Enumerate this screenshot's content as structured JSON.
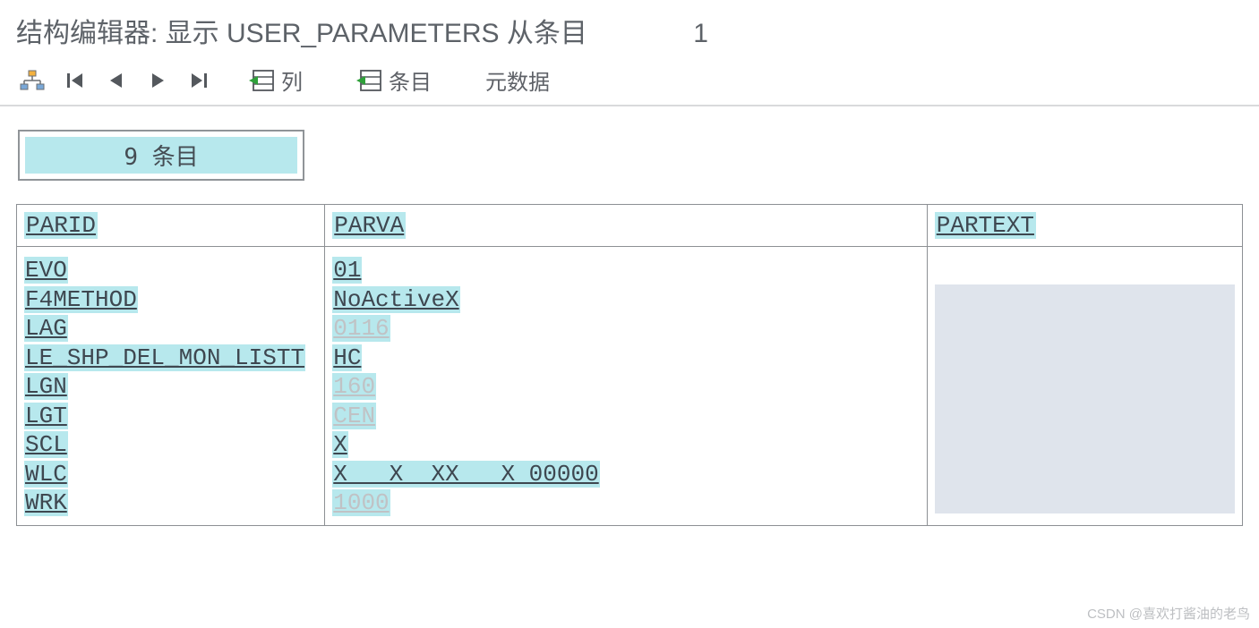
{
  "title": {
    "prefix": "结构编辑器: 显示 ",
    "name": "USER_PARAMETERS",
    "suffix": " 从条目",
    "entry_number": "1"
  },
  "toolbar": {
    "column_label": "列",
    "entry_label": "条目",
    "metadata_label": "元数据"
  },
  "count_box": {
    "count": "9",
    "label": "条目"
  },
  "columns": {
    "parid": "PARID",
    "parva": "PARVA",
    "partext": "PARTEXT"
  },
  "rows": [
    {
      "parid": "EVO",
      "parva": "01",
      "faded": false
    },
    {
      "parid": "F4METHOD",
      "parva": "NoActiveX",
      "faded": false
    },
    {
      "parid": "LAG",
      "parva": "0116",
      "faded": true
    },
    {
      "parid": "LE_SHP_DEL_MON_LISTT",
      "parva": "HC",
      "faded": false
    },
    {
      "parid": "LGN",
      "parva": "160",
      "faded": true
    },
    {
      "parid": "LGT",
      "parva": "CEN",
      "faded": true
    },
    {
      "parid": "SCL",
      "parva": "X",
      "faded": false
    },
    {
      "parid": "WLC",
      "parva": "X   X  XX   X 00000",
      "faded": false
    },
    {
      "parid": "WRK",
      "parva": "1000",
      "faded": true
    }
  ],
  "watermark": "CSDN @喜欢打酱油的老鸟"
}
